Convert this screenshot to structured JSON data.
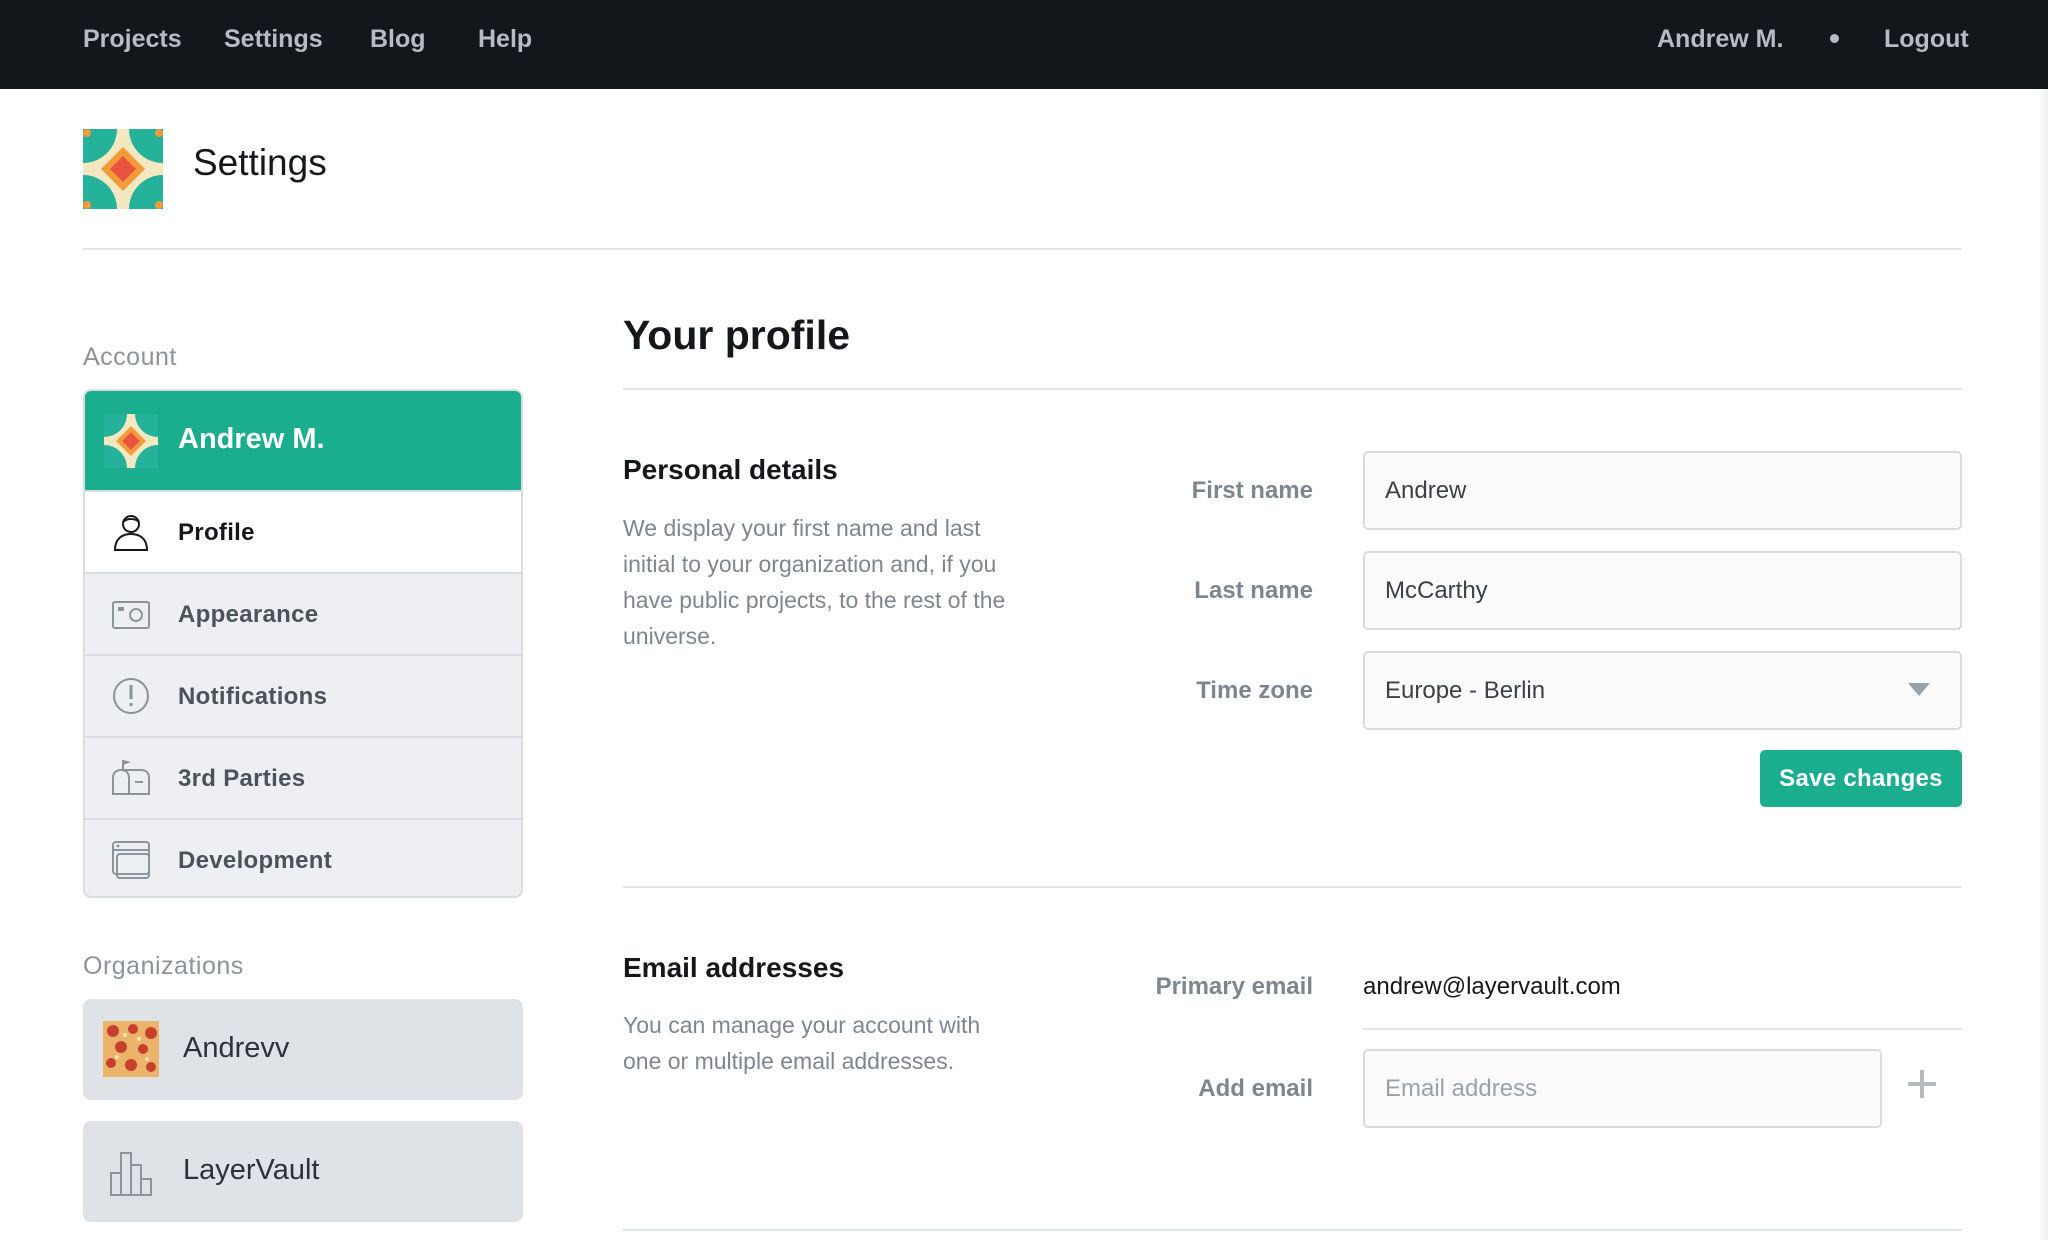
{
  "topnav": {
    "links": [
      "Projects",
      "Settings",
      "Blog",
      "Help"
    ],
    "user": "Andrew M.",
    "logout": "Logout"
  },
  "page": {
    "title": "Settings"
  },
  "sidebar": {
    "account_heading": "Account",
    "account_name": "Andrew M.",
    "items": [
      {
        "label": "Profile",
        "icon": "person-icon",
        "active": true
      },
      {
        "label": "Appearance",
        "icon": "photo-frame-icon",
        "active": false
      },
      {
        "label": "Notifications",
        "icon": "alert-circle-icon",
        "active": false
      },
      {
        "label": "3rd Parties",
        "icon": "mailbox-icon",
        "active": false
      },
      {
        "label": "Development",
        "icon": "browser-window-icon",
        "active": false
      }
    ],
    "organizations_heading": "Organizations",
    "organizations": [
      {
        "name": "Andrevv",
        "icon": "pizza-icon"
      },
      {
        "name": "LayerVault",
        "icon": "bar-chart-icon"
      }
    ]
  },
  "main": {
    "title": "Your profile",
    "personal": {
      "title": "Personal details",
      "description": "We display your first name and last initial to your organization and, if you have public projects, to the rest of the universe.",
      "first_name_label": "First name",
      "first_name_value": "Andrew",
      "last_name_label": "Last name",
      "last_name_value": "McCarthy",
      "timezone_label": "Time zone",
      "timezone_value": "Europe - Berlin",
      "save_label": "Save changes"
    },
    "email": {
      "title": "Email addresses",
      "description": "You can manage your account with one or multiple email addresses.",
      "primary_label": "Primary email",
      "primary_value": "andrew@layervault.com",
      "add_label": "Add email",
      "add_placeholder": "Email address"
    }
  },
  "colors": {
    "accent": "#1bae8e",
    "nav_bg": "#12171c",
    "muted_text": "#7d868f"
  }
}
